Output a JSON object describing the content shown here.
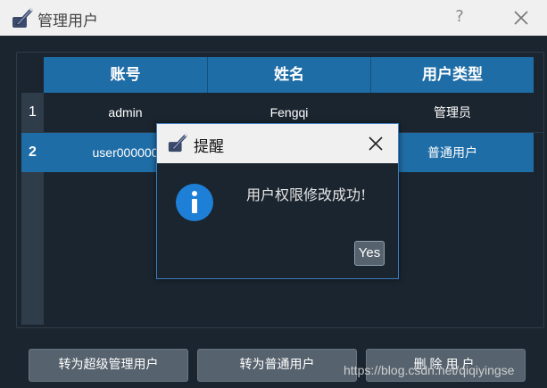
{
  "window": {
    "title": "管理用户",
    "help": "?"
  },
  "table": {
    "columns": [
      "账号",
      "姓名",
      "用户类型"
    ],
    "rows": [
      {
        "num": "1",
        "account": "admin",
        "name": "Fengqi",
        "type": "管理员"
      },
      {
        "num": "2",
        "account": "user000000",
        "name": "",
        "type": "普通用户"
      }
    ]
  },
  "buttons": {
    "promote_super": "转为超级管理用户",
    "demote_normal": "转为普通用户",
    "delete_user": "删除用户"
  },
  "dialog": {
    "title": "提醒",
    "message": "用户权限修改成功!",
    "yes": "Yes"
  },
  "watermark": "https://blog.csdn.net/qiqiyingse",
  "colors": {
    "background": "#1b252f",
    "header_blue": "#1f6da6",
    "button_gray": "#56626d",
    "info_blue": "#1e7fd6"
  }
}
